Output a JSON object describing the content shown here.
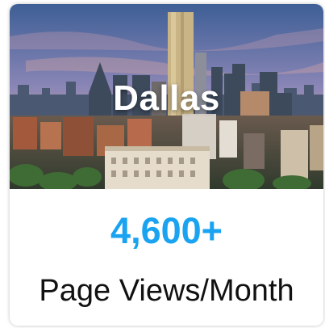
{
  "card": {
    "city": "Dallas",
    "stat_value": "4,600+",
    "stat_label": "Page Views/Month"
  },
  "colors": {
    "accent": "#1aa3f0",
    "label": "#111111",
    "title": "#ffffff"
  }
}
